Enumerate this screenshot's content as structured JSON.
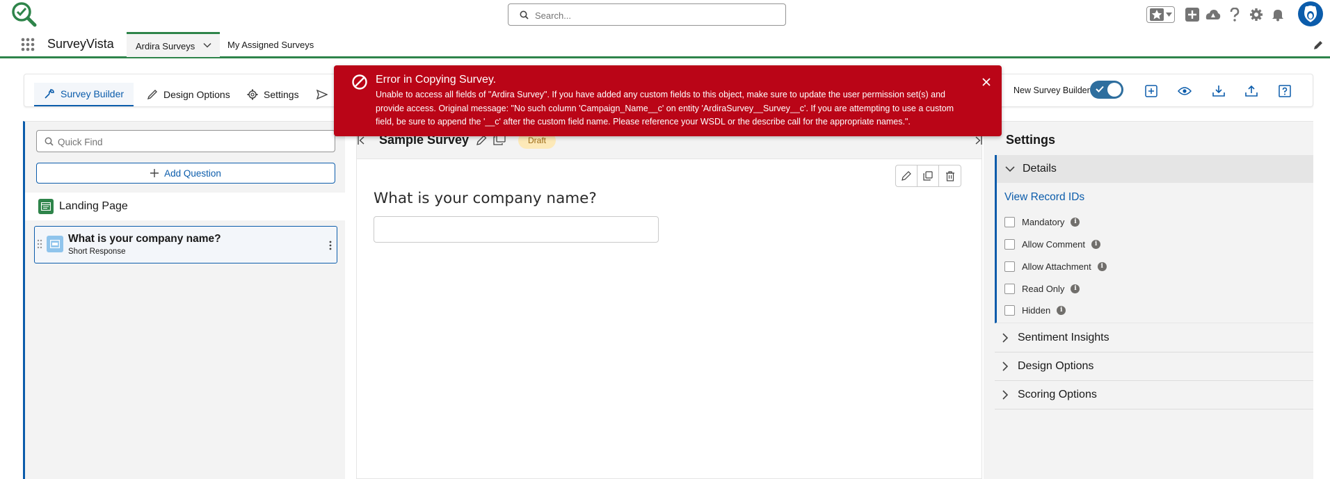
{
  "header": {
    "search_placeholder": "Search...",
    "icons": [
      "app-logo-icon",
      "favorites-star-icon",
      "favorites-dropdown-icon",
      "global-actions-icon",
      "trailhead-icon",
      "help-icon",
      "setup-gear-icon",
      "notifications-bell-icon",
      "user-avatar"
    ]
  },
  "nav": {
    "app_name": "SurveyVista",
    "tabs": [
      {
        "label": "Ardira Surveys",
        "active": true
      },
      {
        "label": "My Assigned Surveys",
        "active": false
      }
    ]
  },
  "builder_tabs": [
    {
      "label": "Survey Builder",
      "icon": "wrench-icon",
      "active": true
    },
    {
      "label": "Design Options",
      "icon": "brush-icon",
      "active": false
    },
    {
      "label": "Settings",
      "icon": "gear-icon",
      "active": false
    },
    {
      "label": "",
      "icon": "send-icon",
      "active": false
    }
  ],
  "toolbar": {
    "new_builder_label": "New Survey Builder",
    "new_builder_on": true,
    "icons": [
      "add-page-icon",
      "preview-eye-icon",
      "download-icon",
      "upload-icon",
      "help-square-icon"
    ]
  },
  "left": {
    "quick_find_placeholder": "Quick Find",
    "add_question_label": "Add Question",
    "landing_page_label": "Landing Page",
    "questions": [
      {
        "title": "What is your company name?",
        "type": "Short Response"
      }
    ]
  },
  "center": {
    "survey_title": "Sample Survey",
    "status_badge": "Draft",
    "question_text": "What is your company name?",
    "answer_value": ""
  },
  "right": {
    "title": "Settings",
    "details_label": "Details",
    "view_record_ids": "View Record IDs",
    "checkboxes": [
      {
        "label": "Mandatory",
        "checked": false
      },
      {
        "label": "Allow Comment",
        "checked": false
      },
      {
        "label": "Allow Attachment",
        "checked": false
      },
      {
        "label": "Read Only",
        "checked": false
      },
      {
        "label": "Hidden",
        "checked": false
      }
    ],
    "sections": [
      "Sentiment Insights",
      "Design Options",
      "Scoring Options"
    ]
  },
  "error": {
    "title": "Error in Copying Survey.",
    "message": "Unable to access all fields of \"Ardira Survey\". If you have added any custom fields to this object, make sure to update the user permission set(s) and provide access. Original message: \"No such column 'Campaign_Name__c' on entity 'ArdiraSurvey__Survey__c'. If you are attempting to use a custom field, be sure to append the '__c' after the custom field name. Please reference your WSDL or the describe call for the appropriate names.\".",
    "color": "#ba0517"
  },
  "colors": {
    "brand_blue": "#0b5cab",
    "nav_green": "#2e844a",
    "draft_bg": "#fde9b8"
  }
}
